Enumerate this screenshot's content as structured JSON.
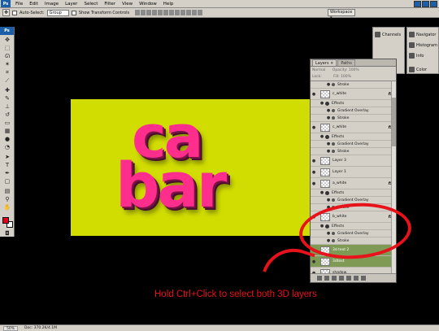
{
  "app": {
    "logo": "Ps"
  },
  "menu": [
    "File",
    "Edit",
    "Image",
    "Layer",
    "Select",
    "Filter",
    "View",
    "Window",
    "Help"
  ],
  "options": {
    "auto_select_label": "Auto-Select:",
    "auto_select_value": "Group",
    "transform_label": "Show Transform Controls",
    "workspace": "Workspace ▾"
  },
  "docks": {
    "channels": "Channels",
    "navigator": "Navigator",
    "histogram": "Histogram",
    "info": "Info",
    "color": "Color"
  },
  "layers_panel": {
    "tabs": [
      "Layers ×",
      "Paths"
    ],
    "blend_mode": "Normal",
    "opacity_label": "Opacity:",
    "opacity_value": "100%",
    "lock_label": "Lock:",
    "fill_label": "Fill:",
    "fill_value": "100%",
    "rows": [
      {
        "kind": "sub",
        "label": "Stroke"
      },
      {
        "kind": "layer",
        "label": "c_white",
        "fx": "fx"
      },
      {
        "kind": "effect",
        "label": "Effects"
      },
      {
        "kind": "sub",
        "label": "Gradient Overlay"
      },
      {
        "kind": "sub",
        "label": "Stroke"
      },
      {
        "kind": "layer",
        "label": "c_white",
        "fx": "fx"
      },
      {
        "kind": "effect",
        "label": "Effects"
      },
      {
        "kind": "sub",
        "label": "Gradient Overlay"
      },
      {
        "kind": "sub",
        "label": "Stroke"
      },
      {
        "kind": "layer",
        "label": "Layer 3",
        "fx": ""
      },
      {
        "kind": "layer",
        "label": "Layer 1",
        "fx": ""
      },
      {
        "kind": "layer",
        "label": "a_white",
        "fx": "fx"
      },
      {
        "kind": "effect",
        "label": "Effects"
      },
      {
        "kind": "sub",
        "label": "Gradient Overlay"
      },
      {
        "kind": "sub",
        "label": "Stroke"
      },
      {
        "kind": "layer",
        "label": "b_white",
        "fx": "fx"
      },
      {
        "kind": "effect",
        "label": "Effects"
      },
      {
        "kind": "sub",
        "label": "Gradient Overlay"
      },
      {
        "kind": "sub",
        "label": "Stroke"
      },
      {
        "kind": "layer",
        "label": "3d text 2",
        "fx": "",
        "selected": true
      },
      {
        "kind": "layer",
        "label": "3dtext",
        "fx": "",
        "selected": true
      },
      {
        "kind": "layer",
        "label": "shadow",
        "fx": ""
      },
      {
        "kind": "layer",
        "label": "background",
        "fx": "fx"
      },
      {
        "kind": "effect",
        "label": "Effects"
      },
      {
        "kind": "sub",
        "label": "Gradient Overlay"
      },
      {
        "kind": "sub",
        "label": "Stroke"
      }
    ]
  },
  "canvas_text": {
    "top": "ca",
    "bottom": "bar"
  },
  "annotation": "Hold Ctrl+Click to select both 3D layers",
  "status": {
    "zoom": "50%",
    "doc": "Doc: 370.2K/4.1M"
  },
  "colors": {
    "canvas": "#d1dd00",
    "pink": "#ff2d8c",
    "annotation_red": "#e8121b",
    "selected_layer": "#7f9a55"
  }
}
